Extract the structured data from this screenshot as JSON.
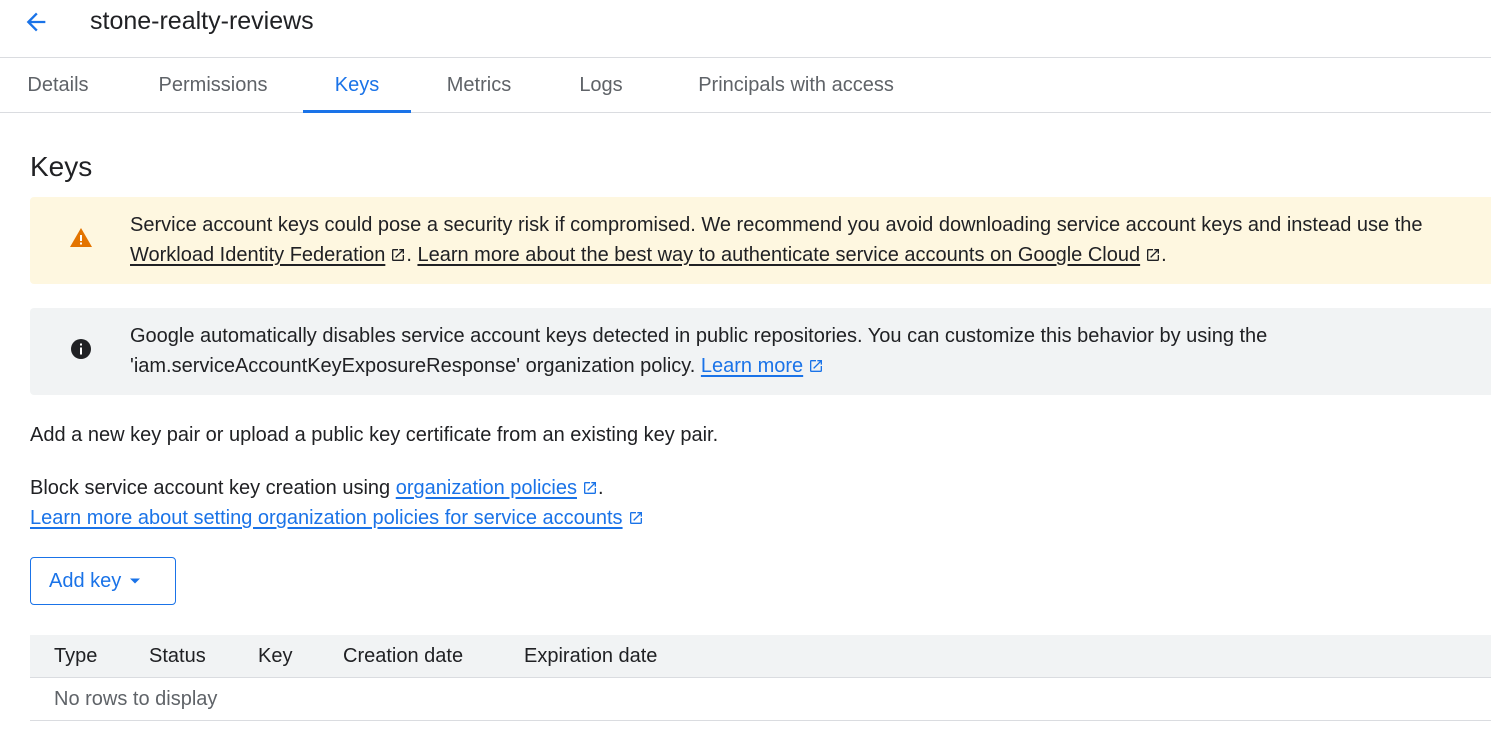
{
  "header": {
    "title": "stone-realty-reviews"
  },
  "tabs": [
    {
      "label": "Details",
      "active": false
    },
    {
      "label": "Permissions",
      "active": false
    },
    {
      "label": "Keys",
      "active": true
    },
    {
      "label": "Metrics",
      "active": false
    },
    {
      "label": "Logs",
      "active": false
    },
    {
      "label": "Principals with access",
      "active": false
    }
  ],
  "section": {
    "title": "Keys"
  },
  "warning_banner": {
    "icon": "warning-icon",
    "text_1": "Service account keys could pose a security risk if compromised. We recommend you avoid downloading service account keys and instead use the ",
    "link_1": "Workload Identity Federation",
    "text_2": ". ",
    "link_2": "Learn more about the best way to authenticate service accounts on Google Cloud",
    "text_3": "."
  },
  "info_banner": {
    "icon": "info-icon",
    "text_1": "Google automatically disables service account keys detected in public repositories. You can customize this behavior by using the 'iam.serviceAccountKeyExposureResponse' organization policy. ",
    "link_1": "Learn more"
  },
  "description": "Add a new key pair or upload a public key certificate from an existing key pair.",
  "policy": {
    "text_1": "Block service account key creation using ",
    "link_1": "organization policies",
    "text_2": ".",
    "link_2": "Learn more about setting organization policies for service accounts"
  },
  "add_key_button": {
    "label": "Add key"
  },
  "table": {
    "columns": [
      "Type",
      "Status",
      "Key",
      "Creation date",
      "Expiration date"
    ],
    "empty_text": "No rows to display"
  },
  "colors": {
    "accent": "#1a73e8",
    "warning_bg": "#fef7e0",
    "warning_icon": "#e37400",
    "info_bg": "#f1f3f4"
  }
}
